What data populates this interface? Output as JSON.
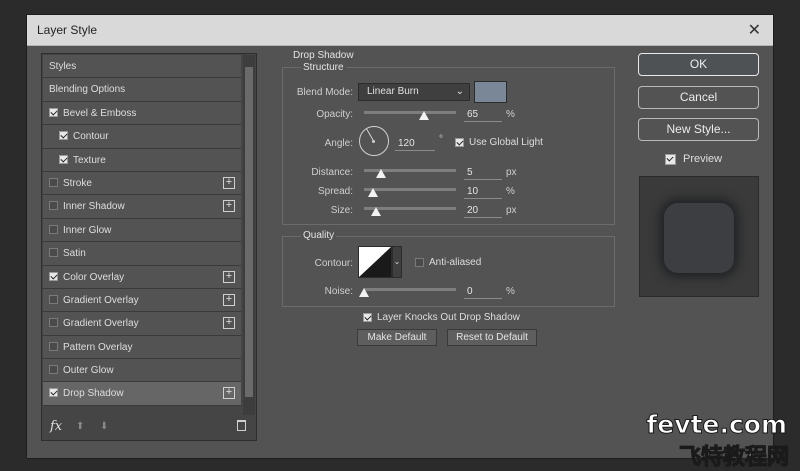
{
  "window": {
    "title": "Layer Style",
    "close_glyph": "✕"
  },
  "styles_list": {
    "items": [
      {
        "label": "Styles",
        "checkbox": false,
        "checked": false,
        "indent": false,
        "plus": false,
        "selected": false
      },
      {
        "label": "Blending Options",
        "checkbox": false,
        "checked": false,
        "indent": false,
        "plus": false,
        "selected": false
      },
      {
        "label": "Bevel & Emboss",
        "checkbox": true,
        "checked": true,
        "indent": false,
        "plus": false,
        "selected": false
      },
      {
        "label": "Contour",
        "checkbox": true,
        "checked": true,
        "indent": true,
        "plus": false,
        "selected": false
      },
      {
        "label": "Texture",
        "checkbox": true,
        "checked": true,
        "indent": true,
        "plus": false,
        "selected": false
      },
      {
        "label": "Stroke",
        "checkbox": true,
        "checked": false,
        "indent": false,
        "plus": true,
        "selected": false
      },
      {
        "label": "Inner Shadow",
        "checkbox": true,
        "checked": false,
        "indent": false,
        "plus": true,
        "selected": false
      },
      {
        "label": "Inner Glow",
        "checkbox": true,
        "checked": false,
        "indent": false,
        "plus": false,
        "selected": false
      },
      {
        "label": "Satin",
        "checkbox": true,
        "checked": false,
        "indent": false,
        "plus": false,
        "selected": false
      },
      {
        "label": "Color Overlay",
        "checkbox": true,
        "checked": true,
        "indent": false,
        "plus": true,
        "selected": false
      },
      {
        "label": "Gradient Overlay",
        "checkbox": true,
        "checked": false,
        "indent": false,
        "plus": true,
        "selected": false
      },
      {
        "label": "Gradient Overlay",
        "checkbox": true,
        "checked": false,
        "indent": false,
        "plus": true,
        "selected": false
      },
      {
        "label": "Pattern Overlay",
        "checkbox": true,
        "checked": false,
        "indent": false,
        "plus": false,
        "selected": false
      },
      {
        "label": "Outer Glow",
        "checkbox": true,
        "checked": false,
        "indent": false,
        "plus": false,
        "selected": false
      },
      {
        "label": "Drop Shadow",
        "checkbox": true,
        "checked": true,
        "indent": false,
        "plus": true,
        "selected": true
      }
    ],
    "footer": {
      "fx_label": "fx",
      "up_glyph": "⬆",
      "down_glyph": "⬇"
    }
  },
  "drop_shadow": {
    "section_title": "Drop Shadow",
    "structure": {
      "title": "Structure",
      "blend_mode_label": "Blend Mode:",
      "blend_mode_value": "Linear Burn",
      "shadow_color": "#7a8796",
      "opacity_label": "Opacity:",
      "opacity_value": "65",
      "opacity_unit": "%",
      "opacity_level": 0.65,
      "angle_label": "Angle:",
      "angle_value": "120",
      "angle_unit": "°",
      "use_global_light_label": "Use Global Light",
      "use_global_light_checked": true,
      "distance_label": "Distance:",
      "distance_value": "5",
      "distance_unit": "px",
      "spread_label": "Spread:",
      "spread_value": "10",
      "spread_unit": "%",
      "size_label": "Size:",
      "size_value": "20",
      "size_unit": "px"
    },
    "quality": {
      "title": "Quality",
      "contour_label": "Contour:",
      "anti_aliased_label": "Anti-aliased",
      "anti_aliased_checked": false,
      "noise_label": "Noise:",
      "noise_value": "0",
      "noise_unit": "%"
    },
    "knocks_out_label": "Layer Knocks Out Drop Shadow",
    "knocks_out_checked": true,
    "make_default_label": "Make Default",
    "reset_default_label": "Reset to Default"
  },
  "actions": {
    "ok_label": "OK",
    "cancel_label": "Cancel",
    "new_style_label": "New Style...",
    "preview_label": "Preview",
    "preview_checked": true
  },
  "watermark": {
    "line1": "fevte.com",
    "line2": "飞特教程网"
  }
}
